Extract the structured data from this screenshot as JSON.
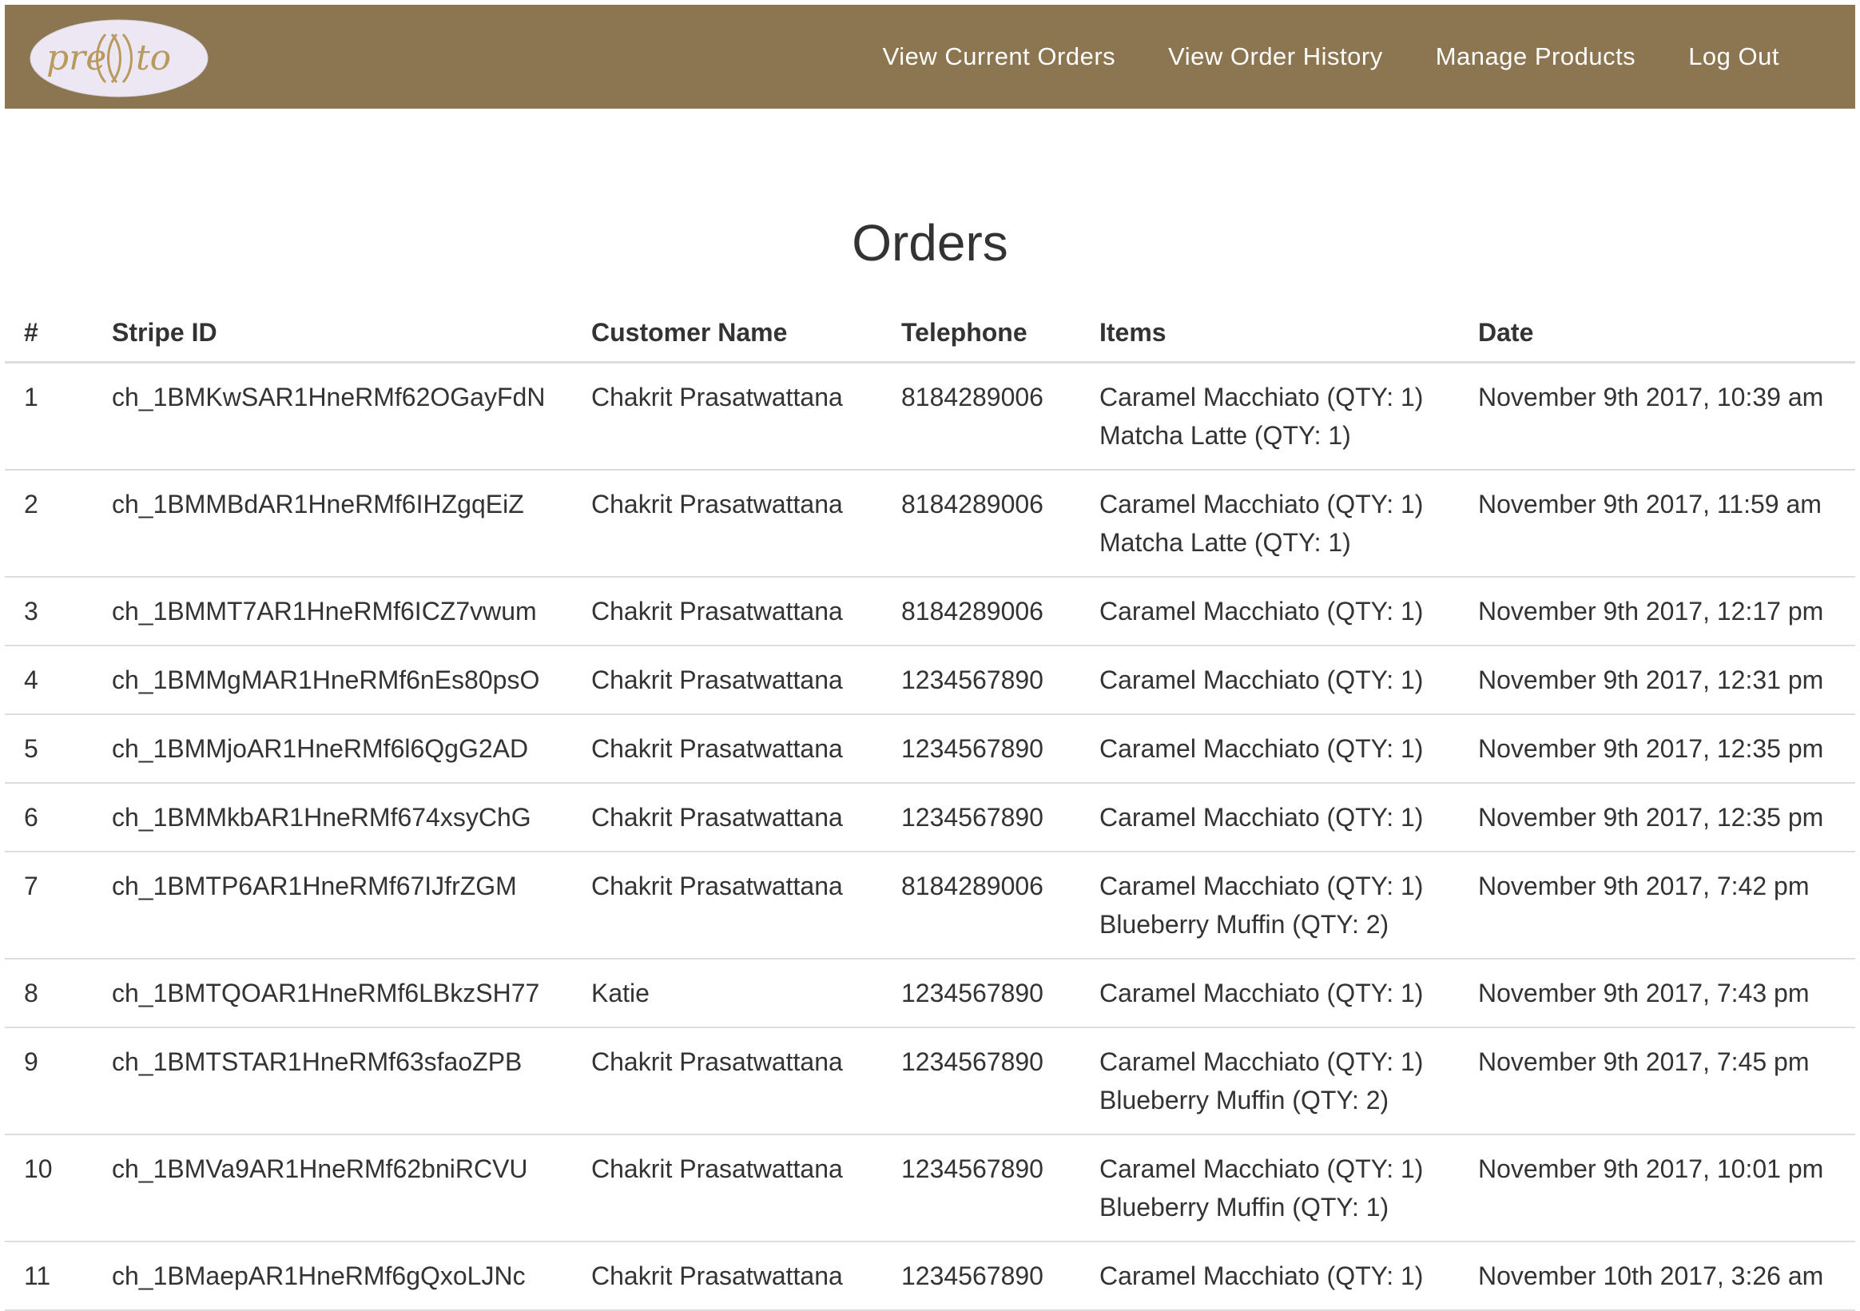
{
  "brand": {
    "logo_text": "presto",
    "colors": {
      "navbar": "#8c7551",
      "nav_text": "#ffffff",
      "logo_bg": "#ede7f3",
      "logo_text": "#b89a5c"
    }
  },
  "nav": {
    "items": [
      {
        "label": "View Current Orders"
      },
      {
        "label": "View Order History"
      },
      {
        "label": "Manage Products"
      },
      {
        "label": "Log Out"
      }
    ]
  },
  "page": {
    "title": "Orders"
  },
  "table": {
    "headers": [
      "#",
      "Stripe ID",
      "Customer Name",
      "Telephone",
      "Items",
      "Date"
    ],
    "rows": [
      {
        "num": "1",
        "stripe_id": "ch_1BMKwSAR1HneRMf62OGayFdN",
        "customer": "Chakrit Prasatwattana",
        "phone": "8184289006",
        "items": [
          "Caramel Macchiato (QTY: 1)",
          "Matcha Latte (QTY: 1)"
        ],
        "date": "November 9th 2017, 10:39 am"
      },
      {
        "num": "2",
        "stripe_id": "ch_1BMMBdAR1HneRMf6IHZgqEiZ",
        "customer": "Chakrit Prasatwattana",
        "phone": "8184289006",
        "items": [
          "Caramel Macchiato (QTY: 1)",
          "Matcha Latte (QTY: 1)"
        ],
        "date": "November 9th 2017, 11:59 am"
      },
      {
        "num": "3",
        "stripe_id": "ch_1BMMT7AR1HneRMf6ICZ7vwum",
        "customer": "Chakrit Prasatwattana",
        "phone": "8184289006",
        "items": [
          "Caramel Macchiato (QTY: 1)"
        ],
        "date": "November 9th 2017, 12:17 pm"
      },
      {
        "num": "4",
        "stripe_id": "ch_1BMMgMAR1HneRMf6nEs80psO",
        "customer": "Chakrit Prasatwattana",
        "phone": "1234567890",
        "items": [
          "Caramel Macchiato (QTY: 1)"
        ],
        "date": "November 9th 2017, 12:31 pm"
      },
      {
        "num": "5",
        "stripe_id": "ch_1BMMjoAR1HneRMf6l6QgG2AD",
        "customer": "Chakrit Prasatwattana",
        "phone": "1234567890",
        "items": [
          "Caramel Macchiato (QTY: 1)"
        ],
        "date": "November 9th 2017, 12:35 pm"
      },
      {
        "num": "6",
        "stripe_id": "ch_1BMMkbAR1HneRMf674xsyChG",
        "customer": "Chakrit Prasatwattana",
        "phone": "1234567890",
        "items": [
          "Caramel Macchiato (QTY: 1)"
        ],
        "date": "November 9th 2017, 12:35 pm"
      },
      {
        "num": "7",
        "stripe_id": "ch_1BMTP6AR1HneRMf67IJfrZGM",
        "customer": "Chakrit Prasatwattana",
        "phone": "8184289006",
        "items": [
          "Caramel Macchiato (QTY: 1)",
          "Blueberry Muffin (QTY: 2)"
        ],
        "date": "November 9th 2017, 7:42 pm"
      },
      {
        "num": "8",
        "stripe_id": "ch_1BMTQOAR1HneRMf6LBkzSH77",
        "customer": "Katie",
        "phone": "1234567890",
        "items": [
          "Caramel Macchiato (QTY: 1)"
        ],
        "date": "November 9th 2017, 7:43 pm"
      },
      {
        "num": "9",
        "stripe_id": "ch_1BMTSTAR1HneRMf63sfaoZPB",
        "customer": "Chakrit Prasatwattana",
        "phone": "1234567890",
        "items": [
          "Caramel Macchiato (QTY: 1)",
          "Blueberry Muffin (QTY: 2)"
        ],
        "date": "November 9th 2017, 7:45 pm"
      },
      {
        "num": "10",
        "stripe_id": "ch_1BMVa9AR1HneRMf62bniRCVU",
        "customer": "Chakrit Prasatwattana",
        "phone": "1234567890",
        "items": [
          "Caramel Macchiato (QTY: 1)",
          "Blueberry Muffin (QTY: 1)"
        ],
        "date": "November 9th 2017, 10:01 pm"
      },
      {
        "num": "11",
        "stripe_id": "ch_1BMaepAR1HneRMf6gQxoLJNc",
        "customer": "Chakrit Prasatwattana",
        "phone": "1234567890",
        "items": [
          "Caramel Macchiato (QTY: 1)"
        ],
        "date": "November 10th 2017, 3:26 am"
      }
    ]
  }
}
